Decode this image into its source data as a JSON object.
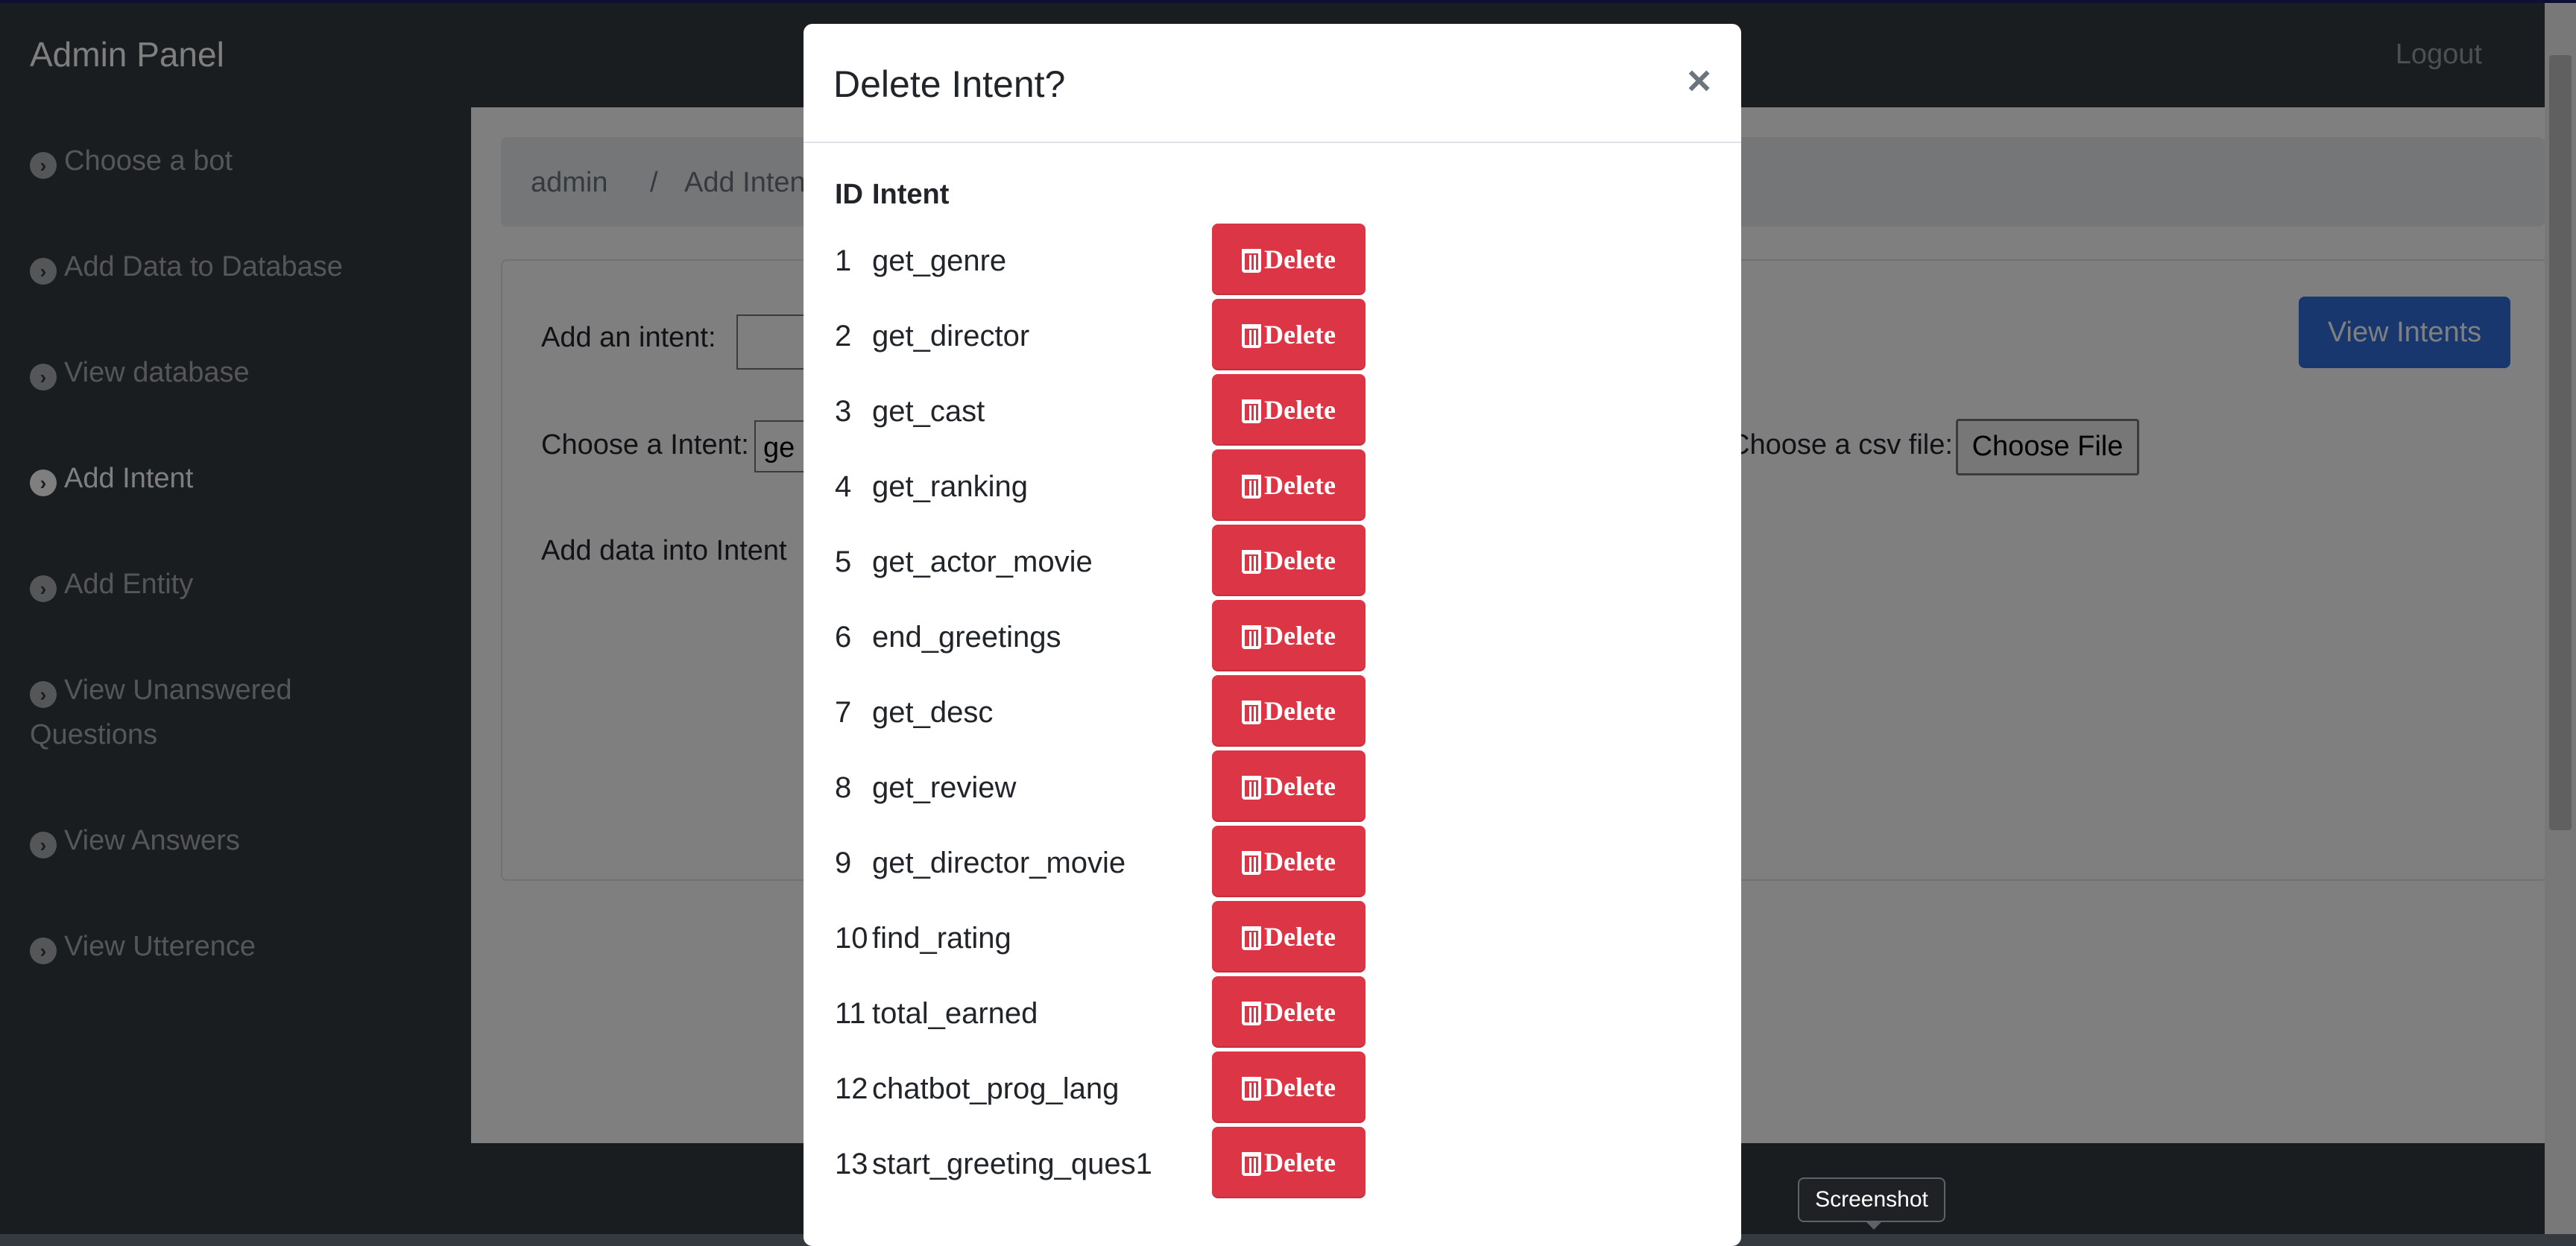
{
  "navbar": {
    "brand": "Admin Panel",
    "logout": "Logout"
  },
  "sidebar": {
    "items": [
      {
        "label": "Choose a bot"
      },
      {
        "label": "Add Data to Database"
      },
      {
        "label": "View database"
      },
      {
        "label": "Add Intent"
      },
      {
        "label": "Add Entity"
      },
      {
        "label": "View Unanswered Questions"
      },
      {
        "label": "View Answers"
      },
      {
        "label": "View Utterence"
      }
    ]
  },
  "breadcrumb": {
    "root": "admin",
    "sep": "/",
    "current": "Add Intents"
  },
  "form": {
    "add_intent_label": "Add an intent:",
    "choose_intent_label": "Choose a Intent:",
    "choose_intent_value": "ge",
    "add_data_label": "Add data into Intent",
    "csv_label": "Choose a csv file:",
    "choose_file_button": "Choose File",
    "view_intents_button": "View Intents"
  },
  "modal": {
    "title": "Delete Intent?",
    "close": "×",
    "header_id": "ID",
    "header_intent": "Intent",
    "delete_label": "Delete",
    "rows": [
      {
        "id": "1",
        "name": "get_genre"
      },
      {
        "id": "2",
        "name": "get_director"
      },
      {
        "id": "3",
        "name": "get_cast"
      },
      {
        "id": "4",
        "name": "get_ranking"
      },
      {
        "id": "5",
        "name": "get_actor_movie"
      },
      {
        "id": "6",
        "name": "end_greetings"
      },
      {
        "id": "7",
        "name": "get_desc"
      },
      {
        "id": "8",
        "name": "get_review"
      },
      {
        "id": "9",
        "name": "get_director_movie"
      },
      {
        "id": "10",
        "name": "find_rating"
      },
      {
        "id": "11",
        "name": "total_earned"
      },
      {
        "id": "12",
        "name": "chatbot_prog_lang"
      },
      {
        "id": "13",
        "name": "start_greeting_ques1"
      }
    ]
  },
  "tooltip": {
    "text": "Screenshot"
  },
  "colors": {
    "danger": "#dc3545",
    "primary": "#2e6fdc",
    "sidebar": "#343a40"
  }
}
